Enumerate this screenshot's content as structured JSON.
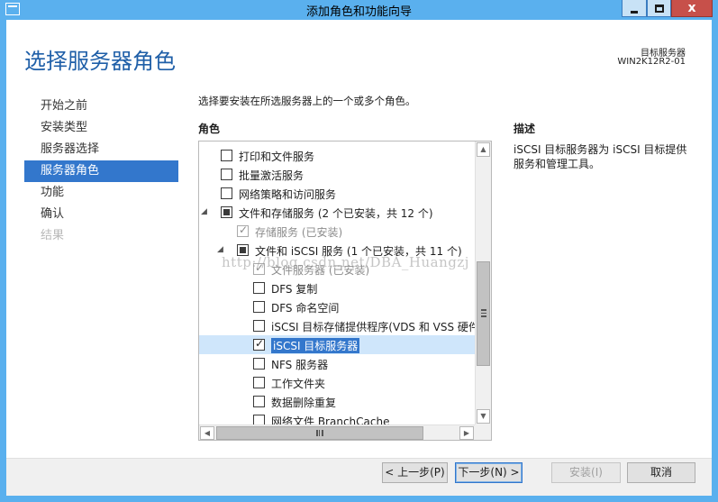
{
  "window": {
    "title": "添加角色和功能向导",
    "minimize_glyph": "",
    "maximize_glyph": "",
    "close_glyph": "x"
  },
  "header": {
    "page_title": "选择服务器角色",
    "destination_label": "目标服务器",
    "destination_name": "WIN2K12R2-01"
  },
  "nav": {
    "items": [
      {
        "label": "开始之前",
        "state": "normal"
      },
      {
        "label": "安装类型",
        "state": "normal"
      },
      {
        "label": "服务器选择",
        "state": "normal"
      },
      {
        "label": "服务器角色",
        "state": "active"
      },
      {
        "label": "功能",
        "state": "normal"
      },
      {
        "label": "确认",
        "state": "normal"
      },
      {
        "label": "结果",
        "state": "disabled"
      }
    ]
  },
  "main": {
    "instruction": "选择要安装在所选服务器上的一个或多个角色。",
    "roles_heading": "角色",
    "description_heading": "描述",
    "description_text": "iSCSI 目标服务器为 iSCSI 目标提供服务和管理工具。"
  },
  "roles": [
    {
      "label": "打印和文件服务",
      "level": 0,
      "expander": "",
      "check": "unchecked",
      "disabled": false,
      "selected": false
    },
    {
      "label": "批量激活服务",
      "level": 0,
      "expander": "",
      "check": "unchecked",
      "disabled": false,
      "selected": false
    },
    {
      "label": "网络策略和访问服务",
      "level": 0,
      "expander": "",
      "check": "unchecked",
      "disabled": false,
      "selected": false
    },
    {
      "label": "文件和存储服务 (2 个已安装，共 12 个)",
      "level": 0,
      "expander": "◢",
      "check": "partial",
      "disabled": false,
      "selected": false
    },
    {
      "label": "存储服务 (已安装)",
      "level": 1,
      "expander": "",
      "check": "checked",
      "disabled": true,
      "selected": false
    },
    {
      "label": "文件和 iSCSI 服务 (1 个已安装，共 11 个)",
      "level": 1,
      "expander": "◢",
      "check": "partial",
      "disabled": false,
      "selected": false
    },
    {
      "label": "文件服务器 (已安装)",
      "level": 2,
      "expander": "",
      "check": "checked",
      "disabled": true,
      "selected": false
    },
    {
      "label": "DFS 复制",
      "level": 2,
      "expander": "",
      "check": "unchecked",
      "disabled": false,
      "selected": false
    },
    {
      "label": "DFS 命名空间",
      "level": 2,
      "expander": "",
      "check": "unchecked",
      "disabled": false,
      "selected": false
    },
    {
      "label": "iSCSI 目标存储提供程序(VDS 和 VSS 硬件提",
      "level": 2,
      "expander": "",
      "check": "unchecked",
      "disabled": false,
      "selected": false
    },
    {
      "label": "iSCSI 目标服务器",
      "level": 2,
      "expander": "",
      "check": "checked",
      "disabled": false,
      "selected": true
    },
    {
      "label": "NFS 服务器",
      "level": 2,
      "expander": "",
      "check": "unchecked",
      "disabled": false,
      "selected": false
    },
    {
      "label": "工作文件夹",
      "level": 2,
      "expander": "",
      "check": "unchecked",
      "disabled": false,
      "selected": false
    },
    {
      "label": "数据删除重复",
      "level": 2,
      "expander": "",
      "check": "unchecked",
      "disabled": false,
      "selected": false
    },
    {
      "label": "网络文件 BranchCache",
      "level": 2,
      "expander": "",
      "check": "unchecked",
      "disabled": false,
      "selected": false
    }
  ],
  "scroll": {
    "up_glyph": "▲",
    "down_glyph": "▼",
    "left_glyph": "◀",
    "right_glyph": "▶"
  },
  "watermark": "http://blog.csdn.net/DBA_Huangzj",
  "footer": {
    "prev_label": "< 上一步(P)",
    "next_label": "下一步(N) >",
    "install_label": "安装(I)",
    "cancel_label": "取消"
  },
  "colors": {
    "frame": "#5ab0ee",
    "accent": "#3377cc",
    "title_text": "#1f5fa8",
    "close_button": "#c7504a"
  }
}
